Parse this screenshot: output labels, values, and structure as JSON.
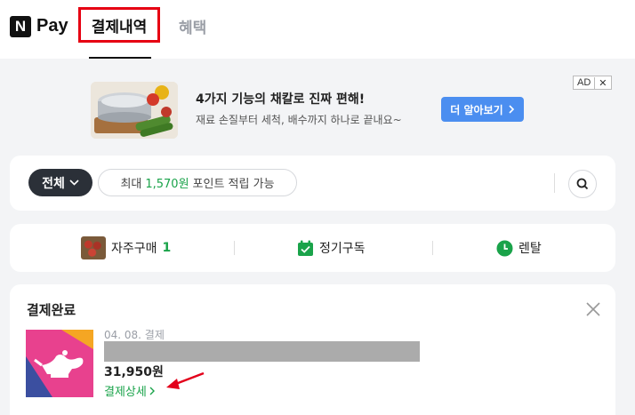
{
  "header": {
    "logo_mark": "N",
    "logo_text": "Pay",
    "tabs": [
      {
        "label": "결제내역",
        "active": true
      },
      {
        "label": "혜택",
        "active": false
      }
    ]
  },
  "ad": {
    "title": "4가지 기능의 채칼로 진짜 편해!",
    "subtitle": "재료 손질부터 세척, 배수까지 하나로 끝내요~",
    "cta_label": "더 알아보기",
    "badge": "AD",
    "badge_close": "✕"
  },
  "filter": {
    "all_label": "전체",
    "point_prefix": "최대",
    "point_amount": "1,570원",
    "point_suffix": "포인트 적립 가능"
  },
  "categories": [
    {
      "label": "자주구매",
      "count": "1",
      "icon": "produce-thumbnail"
    },
    {
      "label": "정기구독",
      "icon": "calendar-check-icon"
    },
    {
      "label": "렌탈",
      "icon": "clock-icon"
    }
  ],
  "order": {
    "section_title": "결제완료",
    "date": "04. 08. 결제",
    "price": "31,950원",
    "detail_link": "결제상세"
  },
  "colors": {
    "naver_green": "#1aa34a",
    "highlight_red": "#e60012",
    "cta_blue": "#4b8ef0",
    "annotation_arrow": "#e3001b"
  }
}
